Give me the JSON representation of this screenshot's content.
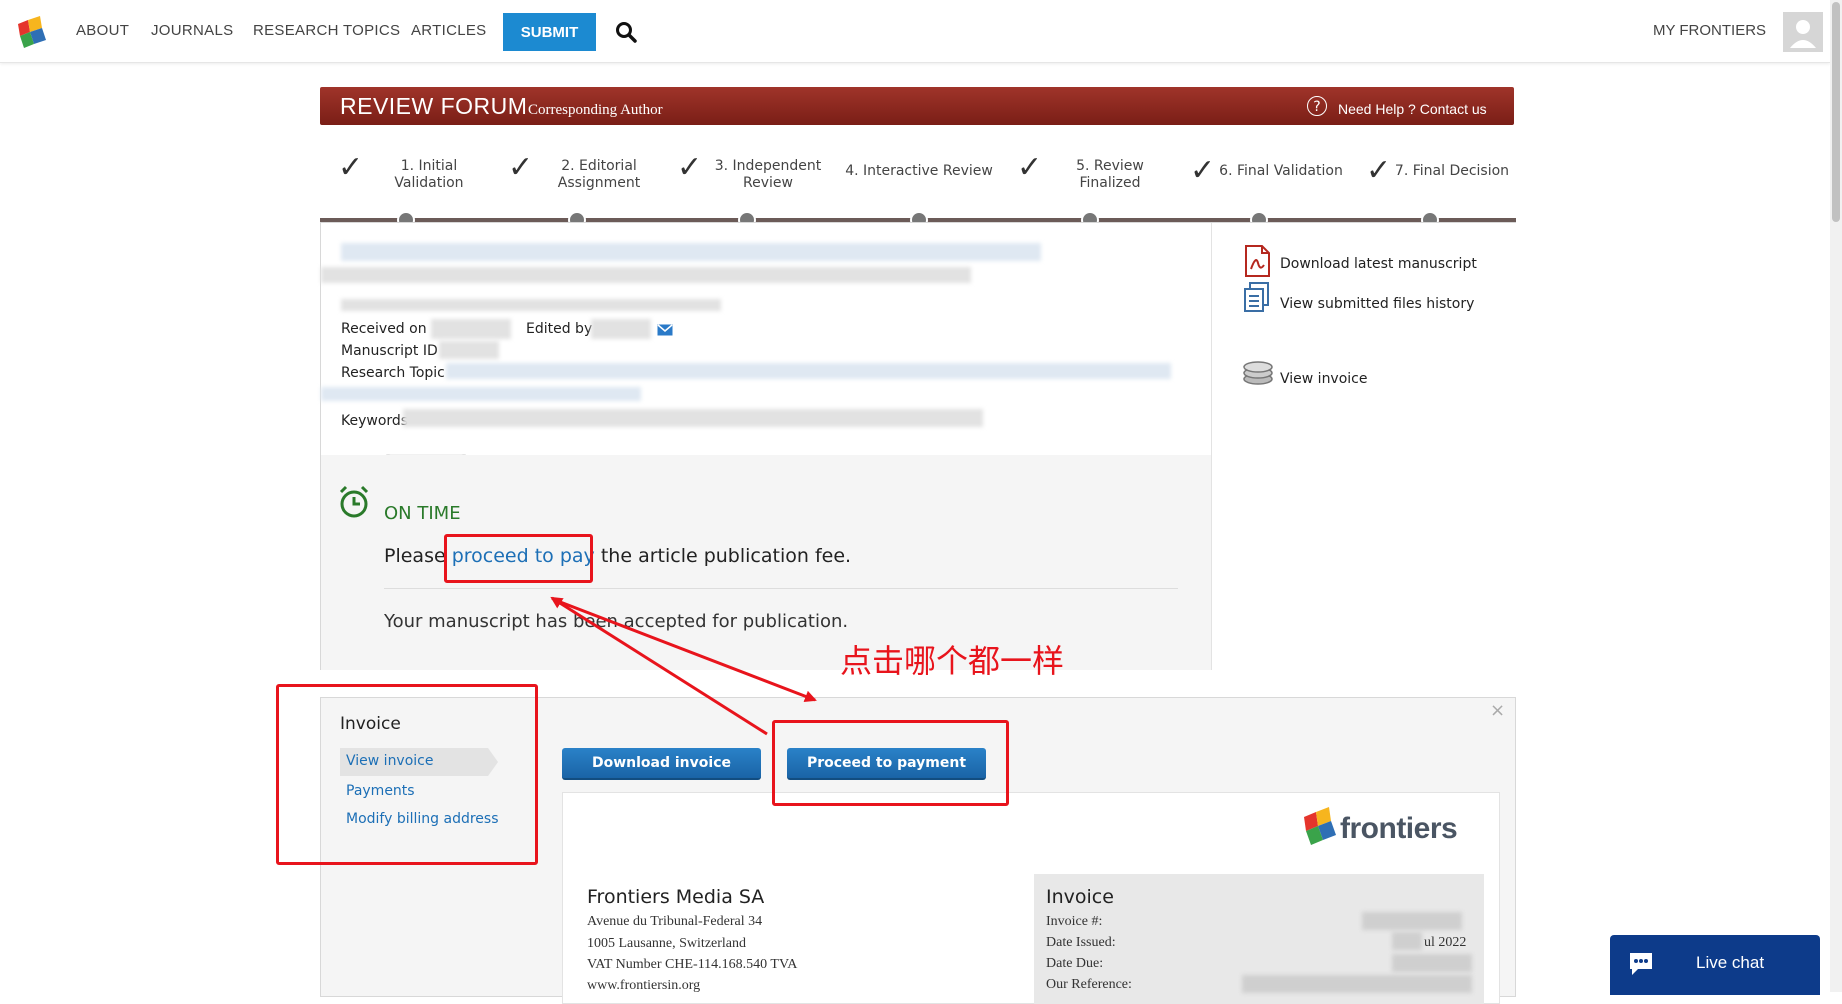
{
  "nav": {
    "items": [
      "ABOUT",
      "JOURNALS",
      "RESEARCH TOPICS",
      "ARTICLES"
    ],
    "submit": "SUBMIT",
    "my_frontiers": "MY FRONTIERS"
  },
  "forum": {
    "title": "REVIEW FORUM",
    "role": "Corresponding Author",
    "help_icon": "?",
    "help_text": "Need Help ? Contact us"
  },
  "steps": [
    {
      "label": "1. Initial\nValidation",
      "done": true
    },
    {
      "label": "2. Editorial\nAssignment",
      "done": true
    },
    {
      "label": "3. Independent\nReview",
      "done": true
    },
    {
      "label": "4. Interactive Review",
      "done": false
    },
    {
      "label": "5. Review\nFinalized",
      "done": true
    },
    {
      "label": "6. Final Validation",
      "done": true
    },
    {
      "label": "7. Final Decision",
      "done": true
    }
  ],
  "manuscript": {
    "received_label": "Received on",
    "edited_label": "Edited by",
    "id_label": "Manuscript ID",
    "topic_label": "Research Topic",
    "keywords_label": "Keywords"
  },
  "sidebar_links": {
    "download": "Download latest manuscript",
    "history": "View submitted files history",
    "invoice": "View invoice"
  },
  "status": {
    "label": "ON TIME",
    "message_pre": "Please",
    "message_link": "proceed to pay",
    "message_post": "the article publication fee.",
    "accepted": "Your manuscript has been accepted for publication."
  },
  "annotation": "点击哪个都一样",
  "invoice_panel": {
    "heading": "Invoice",
    "menu": [
      "View invoice",
      "Payments",
      "Modify billing address"
    ],
    "download_btn": "Download invoice",
    "pay_btn": "Proceed to payment",
    "close": "×"
  },
  "invoice_doc": {
    "brand": "frontiers",
    "company": "Frontiers Media SA",
    "address": [
      "Avenue du Tribunal-Federal 34",
      "1005 Lausanne, Switzerland",
      "VAT Number CHE-114.168.540 TVA",
      "www.frontiersin.org"
    ],
    "box_title": "Invoice",
    "fields": [
      "Invoice #:",
      "Date Issued:",
      "Date Due:",
      "Our Reference:"
    ],
    "date_issued_partial": "ul 2022"
  },
  "live_chat": "Live chat",
  "colors": {
    "brand_red": "#8e2a20",
    "accent_blue": "#1c8ad1",
    "annotation_red": "#e8141c",
    "on_time_green": "#2a7a2a",
    "chat_navy": "#0d3b8a"
  }
}
